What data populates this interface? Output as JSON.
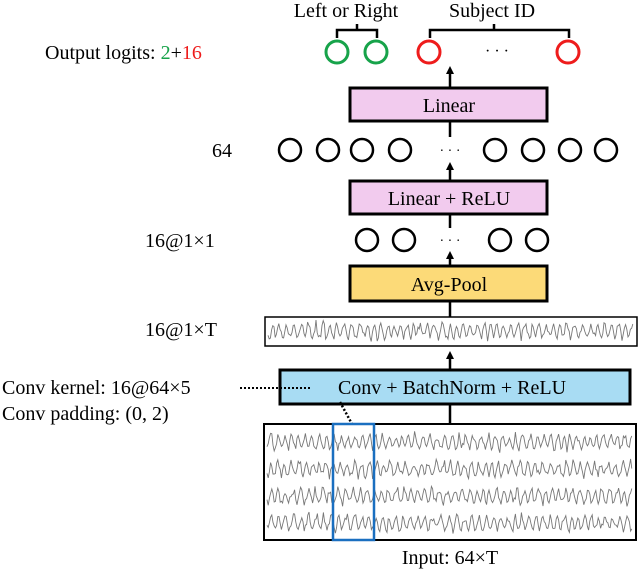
{
  "colors": {
    "linear_box": "#f2cbee",
    "pool_box": "#fcda78",
    "conv_box": "#a8dcf3",
    "green": "#17a34a",
    "red": "#ee1c1c",
    "blue_window": "#1a6fc0",
    "signal": "#777777"
  },
  "header": {
    "left_or_right": "Left or Right",
    "subject_id": "Subject ID"
  },
  "labels": {
    "output_logits_prefix": "Output logits: ",
    "output_logits_green": "2",
    "output_logits_plus": "+",
    "output_logits_red": "16",
    "hidden_64": "64",
    "pooled": "16@1×1",
    "feature_map": "16@1×T",
    "conv_kernel": "Conv kernel: 16@64×5",
    "conv_padding": "Conv padding: (0, 2)",
    "input": "Input: 64×T"
  },
  "blocks": {
    "linear": "Linear",
    "linear_relu": "Linear + ReLU",
    "avg_pool": "Avg-Pool",
    "conv": "Conv + BatchNorm + ReLU"
  },
  "ellipsis": "· · ·",
  "nodes": {
    "output_green_count": 2,
    "output_red_shown": 2,
    "hidden_64_shown": 8,
    "pooled_shown": 4
  },
  "eeg_channels_shown": 4
}
